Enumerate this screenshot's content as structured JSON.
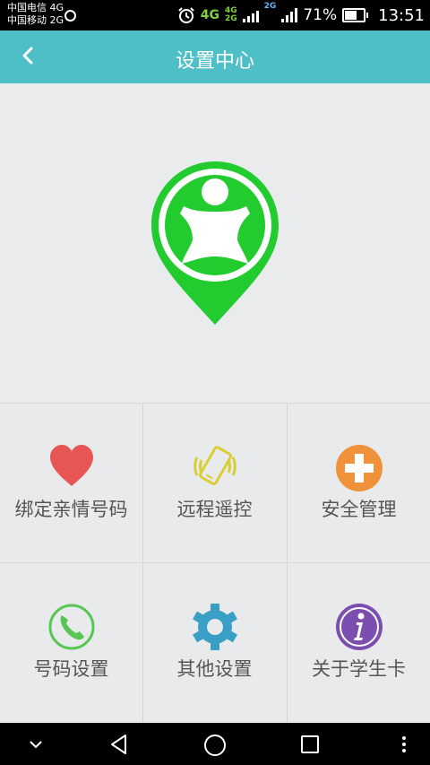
{
  "status_bar": {
    "carrier_1": "中国电信 4G",
    "carrier_2": "中国移动 2G",
    "net_a": "4G",
    "net_b_top": "4G",
    "net_b_bottom": "2G",
    "net_c": "2G",
    "battery_percent": "71%",
    "battery_level": 0.71,
    "time": "13:51"
  },
  "header": {
    "title": "设置中心"
  },
  "menu": {
    "items": [
      {
        "label": "绑定亲情号码",
        "icon": "heart-icon",
        "color": "#e85555"
      },
      {
        "label": "远程遥控",
        "icon": "vibrating-phone-icon",
        "color": "#d8cf36"
      },
      {
        "label": "安全管理",
        "icon": "plus-circle-icon",
        "color": "#f0923a"
      },
      {
        "label": "号码设置",
        "icon": "phone-call-icon",
        "color": "#58c653"
      },
      {
        "label": "其他设置",
        "icon": "gear-icon",
        "color": "#3a9fc7"
      },
      {
        "label": "关于学生卡",
        "icon": "info-icon",
        "color": "#7b4fb0"
      }
    ]
  },
  "colors": {
    "header": "#4fbfc7",
    "logo_green": "#22cc2e",
    "background": "#e9eaeb"
  }
}
